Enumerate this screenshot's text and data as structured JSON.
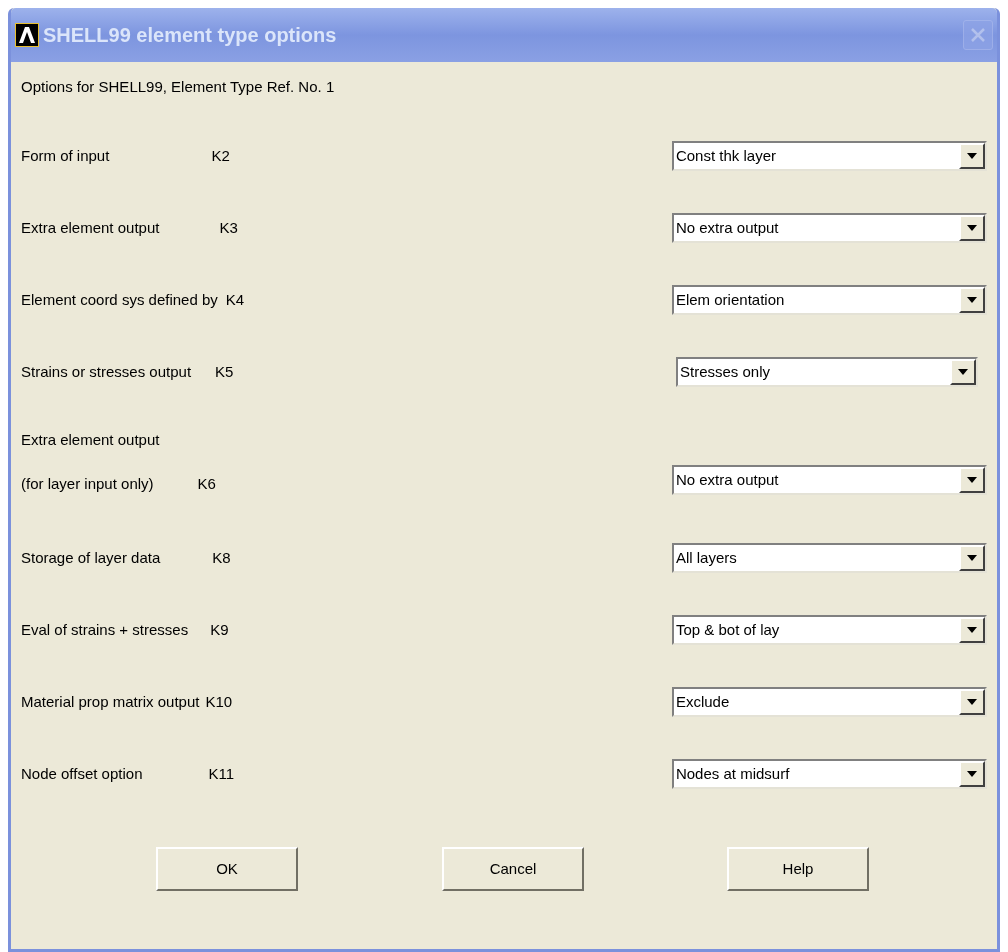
{
  "window": {
    "title": "SHELL99 element type options",
    "close_disabled": true
  },
  "heading": "Options for SHELL99, Element Type Ref. No. 1",
  "options": [
    {
      "label_lines": [
        "Form of input"
      ],
      "key": "K2",
      "value": "Const thk layer"
    },
    {
      "label_lines": [
        "Extra element output"
      ],
      "key": "K3",
      "value": "No extra output"
    },
    {
      "label_lines": [
        "Element coord sys defined by"
      ],
      "key": "K4",
      "value": "Elem orientation"
    },
    {
      "label_lines": [
        "Strains or stresses output"
      ],
      "key": "K5",
      "value": "Stresses only"
    },
    {
      "label_lines": [
        "Extra element output",
        "(for layer input only)"
      ],
      "key": "K6",
      "value": "No extra output"
    },
    {
      "label_lines": [
        "Storage of layer data"
      ],
      "key": "K8",
      "value": "All layers"
    },
    {
      "label_lines": [
        "Eval of strains + stresses"
      ],
      "key": "K9",
      "value": "Top & bot of lay"
    },
    {
      "label_lines": [
        "Material prop matrix output"
      ],
      "key": "K10",
      "value": "Exclude"
    },
    {
      "label_lines": [
        "Node offset option"
      ],
      "key": "K11",
      "value": "Nodes at midsurf"
    }
  ],
  "buttons": [
    "OK",
    "Cancel",
    "Help"
  ]
}
